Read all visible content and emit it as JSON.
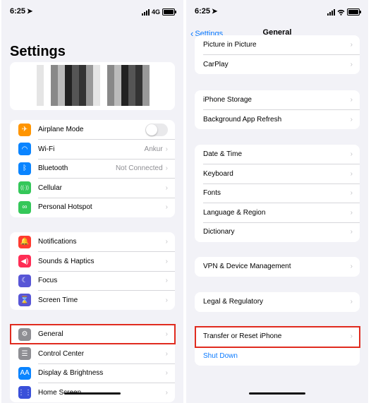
{
  "left_phone": {
    "status": {
      "time": "6:25",
      "network": "4G"
    },
    "title": "Settings",
    "groups": [
      [
        {
          "label": "Airplane Mode",
          "icon": "airplane-icon",
          "color": "#ff9500",
          "glyph": "✈",
          "toggle": true
        },
        {
          "label": "Wi-Fi",
          "icon": "wifi-icon",
          "color": "#0a84ff",
          "glyph": "◠",
          "value": "Ankur"
        },
        {
          "label": "Bluetooth",
          "icon": "bluetooth-icon",
          "color": "#0a84ff",
          "glyph": "ᛒ",
          "value": "Not Connected"
        },
        {
          "label": "Cellular",
          "icon": "cellular-icon",
          "color": "#34c759",
          "glyph": "((·))"
        },
        {
          "label": "Personal Hotspot",
          "icon": "hotspot-icon",
          "color": "#34c759",
          "glyph": "∞"
        }
      ],
      [
        {
          "label": "Notifications",
          "icon": "notifications-icon",
          "color": "#ff3b30",
          "glyph": "🔔"
        },
        {
          "label": "Sounds & Haptics",
          "icon": "sounds-icon",
          "color": "#ff2d55",
          "glyph": "◀)"
        },
        {
          "label": "Focus",
          "icon": "focus-icon",
          "color": "#5856d6",
          "glyph": "☾"
        },
        {
          "label": "Screen Time",
          "icon": "screen-time-icon",
          "color": "#5856d6",
          "glyph": "⌛"
        }
      ],
      [
        {
          "label": "General",
          "icon": "gear-icon",
          "color": "#8e8e93",
          "glyph": "⚙"
        },
        {
          "label": "Control Center",
          "icon": "control-center-icon",
          "color": "#8e8e93",
          "glyph": "☰"
        },
        {
          "label": "Display & Brightness",
          "icon": "display-icon",
          "color": "#0a84ff",
          "glyph": "AA"
        },
        {
          "label": "Home Screen",
          "icon": "home-screen-icon",
          "color": "#3a50d9",
          "glyph": "⋮⋮"
        }
      ]
    ]
  },
  "right_phone": {
    "status": {
      "time": "6:25"
    },
    "nav": {
      "back_label": "Settings",
      "title": "General"
    },
    "groups": [
      [
        "Picture in Picture",
        "CarPlay"
      ],
      [
        "iPhone Storage",
        "Background App Refresh"
      ],
      [
        "Date & Time",
        "Keyboard",
        "Fonts",
        "Language & Region",
        "Dictionary"
      ],
      [
        "VPN & Device Management"
      ],
      [
        "Legal & Regulatory"
      ],
      [
        "Transfer or Reset iPhone"
      ]
    ],
    "shut_down": "Shut Down"
  },
  "colors": {
    "accent": "#0a7aff",
    "highlight": "#e02b1f",
    "background": "#f2f2f7"
  }
}
